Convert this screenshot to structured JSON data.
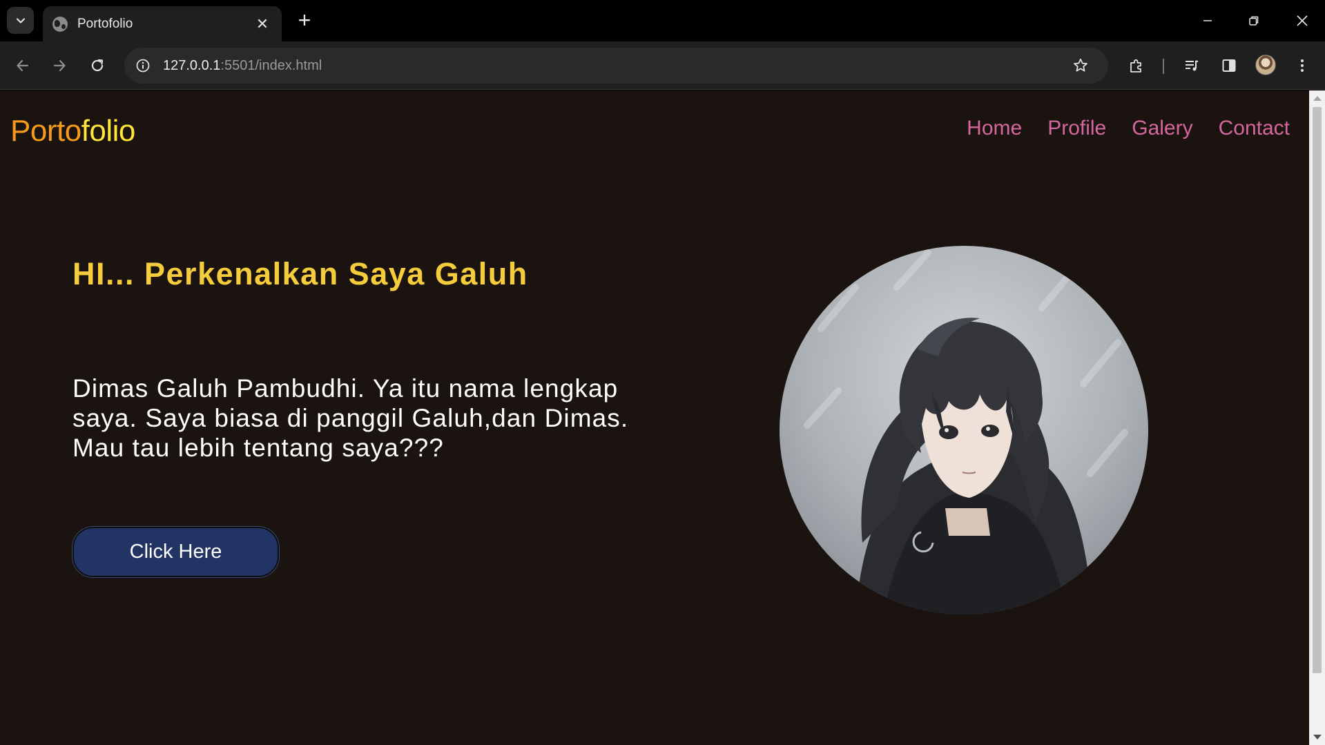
{
  "browser": {
    "tab_title": "Portofolio",
    "url_host": "127.0.0.1",
    "url_rest": ":5501/index.html"
  },
  "page": {
    "logo_part1": "Porto",
    "logo_part2": "folio",
    "nav": [
      {
        "label": "Home"
      },
      {
        "label": "Profile"
      },
      {
        "label": "Galery"
      },
      {
        "label": "Contact"
      }
    ],
    "hero_title": "HI... Perkenalkan Saya Galuh",
    "hero_text": "Dimas Galuh Pambudhi. Ya itu nama lengkap saya. Saya biasa di panggil Galuh,dan Dimas. Mau tau lebih tentang saya???",
    "button_label": "Click Here"
  },
  "colors": {
    "page_bg": "#1b1310",
    "logo_orange": "#f59a1c",
    "logo_yellow": "#ffe43c",
    "nav_pink": "#d5679e",
    "title_gold": "#f5cc3b",
    "button_navy": "#223463"
  },
  "icons": {
    "tab_search": "chevron-down-icon",
    "favicon": "globe-icon",
    "back": "arrow-left-icon",
    "forward": "arrow-right-icon",
    "reload": "reload-icon",
    "site_info": "info-icon",
    "bookmark": "star-icon",
    "extensions": "puzzle-icon",
    "media": "media-queue-icon",
    "side_panel": "side-panel-icon",
    "menu": "kebab-menu-icon"
  }
}
